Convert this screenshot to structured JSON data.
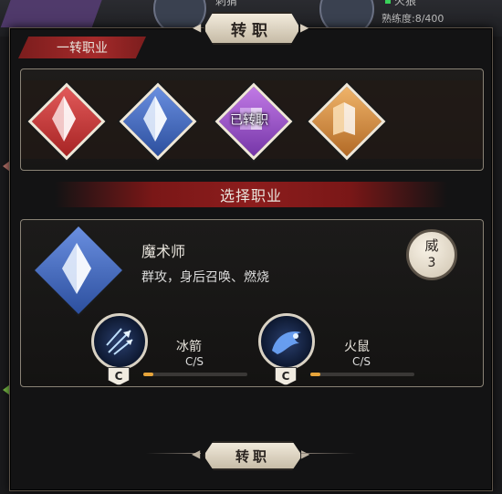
{
  "background": {
    "npc_name": "刺猬",
    "enemy_name": "火狼",
    "proficiency": "熟练度:8/400"
  },
  "dialog": {
    "title": "转职",
    "section_first_job": "一转职业",
    "select_header": "选择职业",
    "action_button": "转职"
  },
  "jobs": [
    {
      "color": "red",
      "selected": false,
      "transferred": false
    },
    {
      "color": "blue",
      "selected": true,
      "transferred": false
    },
    {
      "color": "purple",
      "selected": false,
      "transferred": true,
      "status_label": "已转职"
    },
    {
      "color": "orange",
      "selected": false,
      "transferred": false
    }
  ],
  "selected_job": {
    "name": "魔术师",
    "description": "群攻，身后召唤、燃烧",
    "badge_char": "威",
    "badge_value": "3",
    "skills": [
      {
        "name": "冰箭",
        "icon": "ice-arrow-icon",
        "rank": "C",
        "value_label": "C/S",
        "progress": 0.1
      },
      {
        "name": "火鼠",
        "icon": "fire-rat-icon",
        "rank": "C",
        "value_label": "C/S",
        "progress": 0.1
      }
    ]
  }
}
